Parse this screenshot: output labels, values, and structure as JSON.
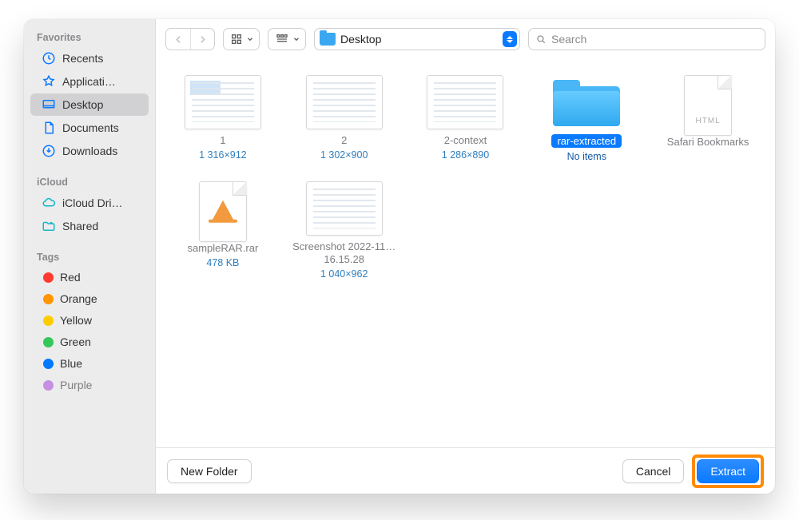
{
  "sidebar": {
    "sections": [
      {
        "heading": "Favorites",
        "items": [
          {
            "label": "Recents",
            "icon": "clock-icon"
          },
          {
            "label": "Applicati…",
            "icon": "applications-icon"
          },
          {
            "label": "Desktop",
            "icon": "desktop-icon",
            "selected": true
          },
          {
            "label": "Documents",
            "icon": "document-icon"
          },
          {
            "label": "Downloads",
            "icon": "download-icon"
          }
        ]
      },
      {
        "heading": "iCloud",
        "items": [
          {
            "label": "iCloud Dri…",
            "icon": "cloud-icon"
          },
          {
            "label": "Shared",
            "icon": "shared-folder-icon"
          }
        ]
      },
      {
        "heading": "Tags",
        "items": [
          {
            "label": "Red",
            "color": "#ff3b30"
          },
          {
            "label": "Orange",
            "color": "#ff9500"
          },
          {
            "label": "Yellow",
            "color": "#ffcc00"
          },
          {
            "label": "Green",
            "color": "#34c759"
          },
          {
            "label": "Blue",
            "color": "#007aff"
          },
          {
            "label": "Purple",
            "color": "#af52de"
          }
        ]
      }
    ]
  },
  "toolbar": {
    "location_label": "Desktop",
    "search_placeholder": "Search"
  },
  "files": [
    {
      "name": "1",
      "meta": "1 316×912",
      "kind": "image-doc-blue"
    },
    {
      "name": "2",
      "meta": "1 302×900",
      "kind": "image-doc"
    },
    {
      "name": "2-context",
      "meta": "1 286×890",
      "kind": "image-doc"
    },
    {
      "name": "rar-extracted",
      "meta": "No items",
      "kind": "folder",
      "selected": true
    },
    {
      "name": "Safari Bookmarks",
      "meta": "",
      "kind": "html-file"
    },
    {
      "name": "sampleRAR.rar",
      "meta": "478 KB",
      "kind": "rar-file"
    },
    {
      "name": "Screenshot 2022-11…16.15.28",
      "meta": "1 040×962",
      "kind": "image-doc"
    }
  ],
  "footer": {
    "new_folder": "New Folder",
    "cancel": "Cancel",
    "extract": "Extract"
  },
  "colors": {
    "accent": "#0a7aff",
    "highlight": "#ff8a00"
  }
}
